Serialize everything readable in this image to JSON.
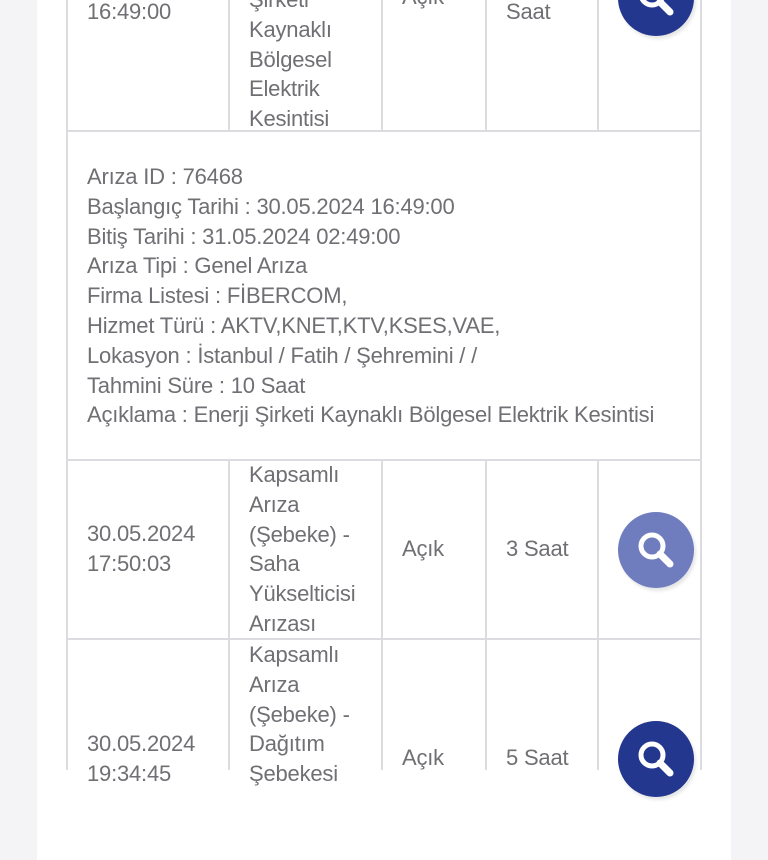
{
  "colors": {
    "search_active": "#24378f",
    "search_disabled": "#6f7cbe",
    "text": "#6f6f74",
    "border": "#dcdce0"
  },
  "rows": [
    {
      "date": "16:49:00",
      "description": [
        "Şirketi",
        "Kaynaklı",
        "Bölgesel",
        "Elektrik",
        "Kesintisi"
      ],
      "status": "Açık",
      "duration": "Saat",
      "search_icon": "search-icon"
    },
    {
      "date": "30.05.2024 17:50:03",
      "date_lines": [
        "30.05.2024",
        "17:50:03"
      ],
      "description": [
        "Kapsamlı",
        "Arıza",
        "(Şebeke) -",
        "Saha",
        "Yükselticisi",
        "Arızası"
      ],
      "status": "Açık",
      "duration": "3 Saat",
      "search_icon": "search-icon"
    },
    {
      "date_lines": [
        "30.05.2024",
        "19:34:45"
      ],
      "description": [
        "Kapsamlı",
        "Arıza",
        "(Şebeke) -",
        "Dağıtım",
        "Şebekesi"
      ],
      "status": "Açık",
      "duration": "5 Saat",
      "search_icon": "search-icon"
    }
  ],
  "detail": {
    "ariza_id": "Arıza ID : 76468",
    "baslangic": "Başlangıç Tarihi : 30.05.2024 16:49:00",
    "bitis": "Bitiş Tarihi : 31.05.2024 02:49:00",
    "ariza_tipi": "Arıza Tipi : Genel Arıza",
    "firma": "Firma Listesi : FİBERCOM,",
    "hizmet": "Hizmet Türü : AKTV,KNET,KTV,KSES,VAE,",
    "lokasyon": "Lokasyon : İstanbul / Fatih / Şehremini / /",
    "sure": "Tahmini Süre : 10 Saat",
    "aciklama": "Açıklama : Enerji Şirketi Kaynaklı Bölgesel Elektrik Kesintisi"
  }
}
